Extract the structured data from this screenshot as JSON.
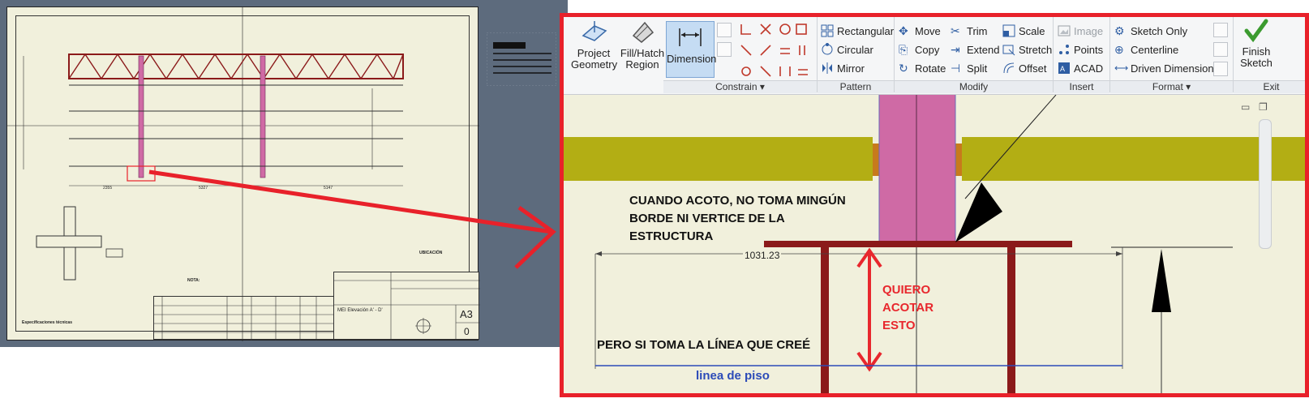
{
  "ribbon": {
    "create": {
      "project_geometry": "Project\nGeometry",
      "fill_hatch_region": "Fill/Hatch\nRegion",
      "dimension": "Dimension"
    },
    "groups": {
      "constrain": "Constrain ▾",
      "pattern": "Pattern",
      "modify": "Modify",
      "insert": "Insert",
      "format": "Format ▾",
      "exit": "Exit"
    },
    "pattern": {
      "rectangular": "Rectangular",
      "circular": "Circular",
      "mirror": "Mirror"
    },
    "modify": {
      "move": "Move",
      "trim": "Trim",
      "scale": "Scale",
      "copy": "Copy",
      "extend": "Extend",
      "stretch": "Stretch",
      "rotate": "Rotate",
      "split": "Split",
      "offset": "Offset"
    },
    "insert": {
      "image": "Image",
      "points": "Points",
      "acad": "ACAD"
    },
    "format": {
      "sketch_only": "Sketch Only",
      "centerline": "Centerline",
      "driven_dimension": "Driven Dimension"
    },
    "exit": {
      "finish_sketch": "Finish\nSketch"
    }
  },
  "canvas": {
    "dimension_value": "1031.23",
    "note_top": "CUANDO ACOTO, NO TOMA MINGÚN\nBORDE NI VERTICE DE LA\nESTRUCTURA",
    "note_red": "QUIERO\nACOTAR\nESTO",
    "note_bottom": "PERO SI TOMA LA LÍNEA QUE CREÉ",
    "floor_line_label": "linea de piso"
  },
  "sheet": {
    "sheet_size": "A3",
    "sheet_number": "0",
    "view_label": "MEI Elevación A' - D'",
    "nota_title": "NOTA:",
    "ubicacion_title": "UBICACIÓN",
    "dims": [
      "2355",
      "5327",
      "5147"
    ],
    "notes_text": "Especificaciones técnicas"
  },
  "colors": {
    "frame_red": "#e8212a",
    "beam_olive": "#b3ae14",
    "column_pink": "#cf6aa5",
    "plate_red": "#8b1a1a",
    "floor_blue": "#2c4bb8"
  }
}
